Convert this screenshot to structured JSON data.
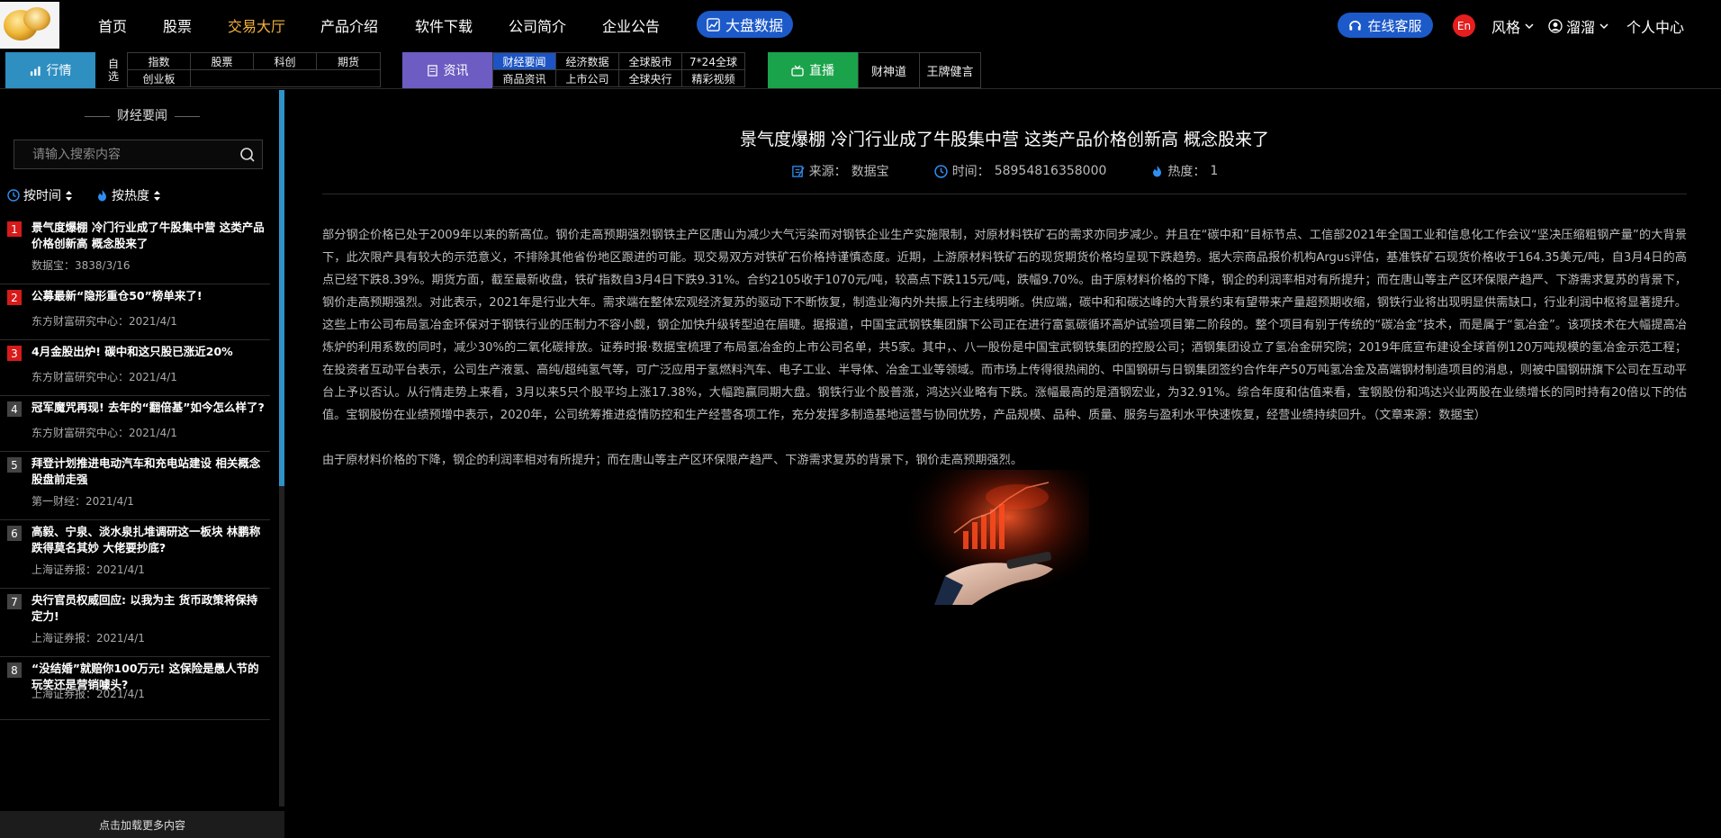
{
  "nav": {
    "items": [
      "首页",
      "股票",
      "交易大厅",
      "产品介绍",
      "软件下载",
      "公司简介",
      "企业公告"
    ],
    "active_index": 2,
    "bigdata_label": "大盘数据",
    "service_label": "在线客服",
    "lang_label": "En",
    "style_label": "风格",
    "user_label": "溜溜",
    "personal_center_label": "个人中心"
  },
  "subnav": {
    "market_label": "行情",
    "zixuan_label": "自选",
    "market_cells": [
      "指数",
      "股票",
      "科创",
      "期货",
      "创业板"
    ],
    "info_label": "资讯",
    "info_cells": [
      "财经要闻",
      "经济数据",
      "全球股市",
      "7*24全球",
      "商品资讯",
      "上市公司",
      "全球央行",
      "精彩视频"
    ],
    "info_selected_index": 0,
    "live_label": "直播",
    "live_cells": [
      "财神道",
      "王牌健言"
    ]
  },
  "sidebar": {
    "title": "财经要闻",
    "search_placeholder": "请输入搜索内容",
    "sort_time_label": "按时间",
    "sort_hot_label": "按热度",
    "load_more_label": "点击加载更多内容",
    "news": [
      {
        "num": "1",
        "title": "景气度爆棚 冷门行业成了牛股集中营 这类产品价格创新高 概念股来了",
        "meta": "数据宝：3838/3/16",
        "hot": true
      },
      {
        "num": "2",
        "title": "公募最新“隐形重仓50”榜单来了!",
        "meta": "东方财富研究中心：2021/4/1",
        "hot": true
      },
      {
        "num": "3",
        "title": "4月金股出炉! 碳中和这只股已涨近20%",
        "meta": "东方财富研究中心：2021/4/1",
        "hot": true
      },
      {
        "num": "4",
        "title": "冠军魔咒再现! 去年的“翻倍基”如今怎么样了?",
        "meta": "东方财富研究中心：2021/4/1",
        "hot": false
      },
      {
        "num": "5",
        "title": "拜登计划推进电动汽车和充电站建设 相关概念股盘前走强",
        "meta": "第一财经：2021/4/1",
        "hot": false
      },
      {
        "num": "6",
        "title": "高毅、宁泉、淡水泉扎堆调研这一板块 林鹏称跌得莫名其妙 大佬要抄底?",
        "meta": "上海证券报：2021/4/1",
        "hot": false
      },
      {
        "num": "7",
        "title": "央行官员权威回应: 以我为主 货币政策将保持定力!",
        "meta": "上海证券报：2021/4/1",
        "hot": false
      },
      {
        "num": "8",
        "title": "“没结婚”就赔你100万元! 这保险是愚人节的玩笑还是营销噱头?",
        "meta": "上海证券报：2021/4/1",
        "hot": false
      }
    ]
  },
  "article": {
    "title": "景气度爆棚 冷门行业成了牛股集中营 这类产品价格创新高 概念股来了",
    "source_label": "来源：",
    "source": "数据宝",
    "time_label": "时间：",
    "time": "58954816358000",
    "hot_label": "热度：",
    "hot": "1",
    "body": "部分钢企价格已处于2009年以来的新高位。钢价走高预期强烈钢铁主产区唐山为减少大气污染而对钢铁企业生产实施限制，对原材料铁矿石的需求亦同步减少。并且在“碳中和”目标节点、工信部2021年全国工业和信息化工作会议“坚决压缩粗钢产量”的大背景下，此次限产具有较大的示范意义，不排除其他省份地区跟进的可能。现交易双方对铁矿石价格持谨慎态度。近期，上游原材料铁矿石的现货期货价格均呈现下跌趋势。据大宗商品报价机构Argus评估，基准铁矿石现货价格收于164.35美元/吨，自3月4日的高点已经下跌8.39%。期货方面，截至最新收盘，铁矿指数自3月4日下跌9.31%。合约2105收于1070元/吨，较高点下跌115元/吨，跌幅9.70%。由于原材料价格的下降，钢企的利润率相对有所提升；而在唐山等主产区环保限产趋严、下游需求复苏的背景下，钢价走高预期强烈。对此表示，2021年是行业大年。需求端在整体宏观经济复苏的驱动下不断恢复，制造业海内外共振上行主线明晰。供应端，碳中和和碳达峰的大背景约束有望带来产量超预期收缩，钢铁行业将出现明显供需缺口，行业利润中枢将显著提升。这些上市公司布局氢冶金环保对于钢铁行业的压制力不容小觑，钢企加快升级转型迫在眉睫。据报道，中国宝武钢铁集团旗下公司正在进行富氢碳循环高炉试验项目第二阶段的。整个项目有别于传统的“碳冶金”技术，而是属于“氢冶金”。该项技术在大幅提高冶炼炉的利用系数的同时，减少30%的二氧化碳排放。证券时报·数据宝梳理了布局氢冶金的上市公司名单，共5家。其中，、八一股份是中国宝武钢铁集团的控股公司；酒钢集团设立了氢冶金研究院；2019年底宣布建设全球首例120万吨规模的氢冶金示范工程；在投资者互动平台表示，公司生产液氢、高纯/超纯氢气等，可广泛应用于氢燃料汽车、电子工业、半导体、冶金工业等领域。而市场上传得很热闹的、中国钢研与日钢集团签约合作年产50万吨氢冶金及高端钢材制造项目的消息，则被中国钢研旗下公司在互动平台上予以否认。从行情走势上来看，3月以来5只个股平均上涨17.38%，大幅跑赢同期大盘。钢铁行业个股普涨，鸿达兴业略有下跌。涨幅最高的是酒钢宏业，为32.91%。综合年度和估值来看，宝钢股份和鸿达兴业两股在业绩增长的同时持有20倍以下的估值。宝钢股份在业绩预增中表示，2020年，公司统筹推进疫情防控和生产经营各项工作，充分发挥多制造基地运营与协同优势，产品规模、品种、质量、服务与盈利水平快速恢复，经营业绩持续回升。（文章来源：数据宝）",
    "body2": "由于原材料价格的下降，钢企的利润率相对有所提升；而在唐山等主产区环保限产趋严、下游需求复苏的背景下，钢价走高预期强烈。"
  },
  "colors": {
    "accent_blue": "#1d5ac9",
    "active_nav": "#f3b33d",
    "hot_red": "#d71a1a",
    "market_tab": "#2e8fc0",
    "info_tab": "#6d5cc2",
    "live_tab": "#1aa34a"
  },
  "icons": {
    "chart": "chart-line-icon",
    "service": "headset-icon",
    "user": "user-icon",
    "search": "search-icon",
    "clock": "clock-icon",
    "fire": "fire-icon",
    "sort": "sort-icon",
    "doc": "document-icon"
  }
}
